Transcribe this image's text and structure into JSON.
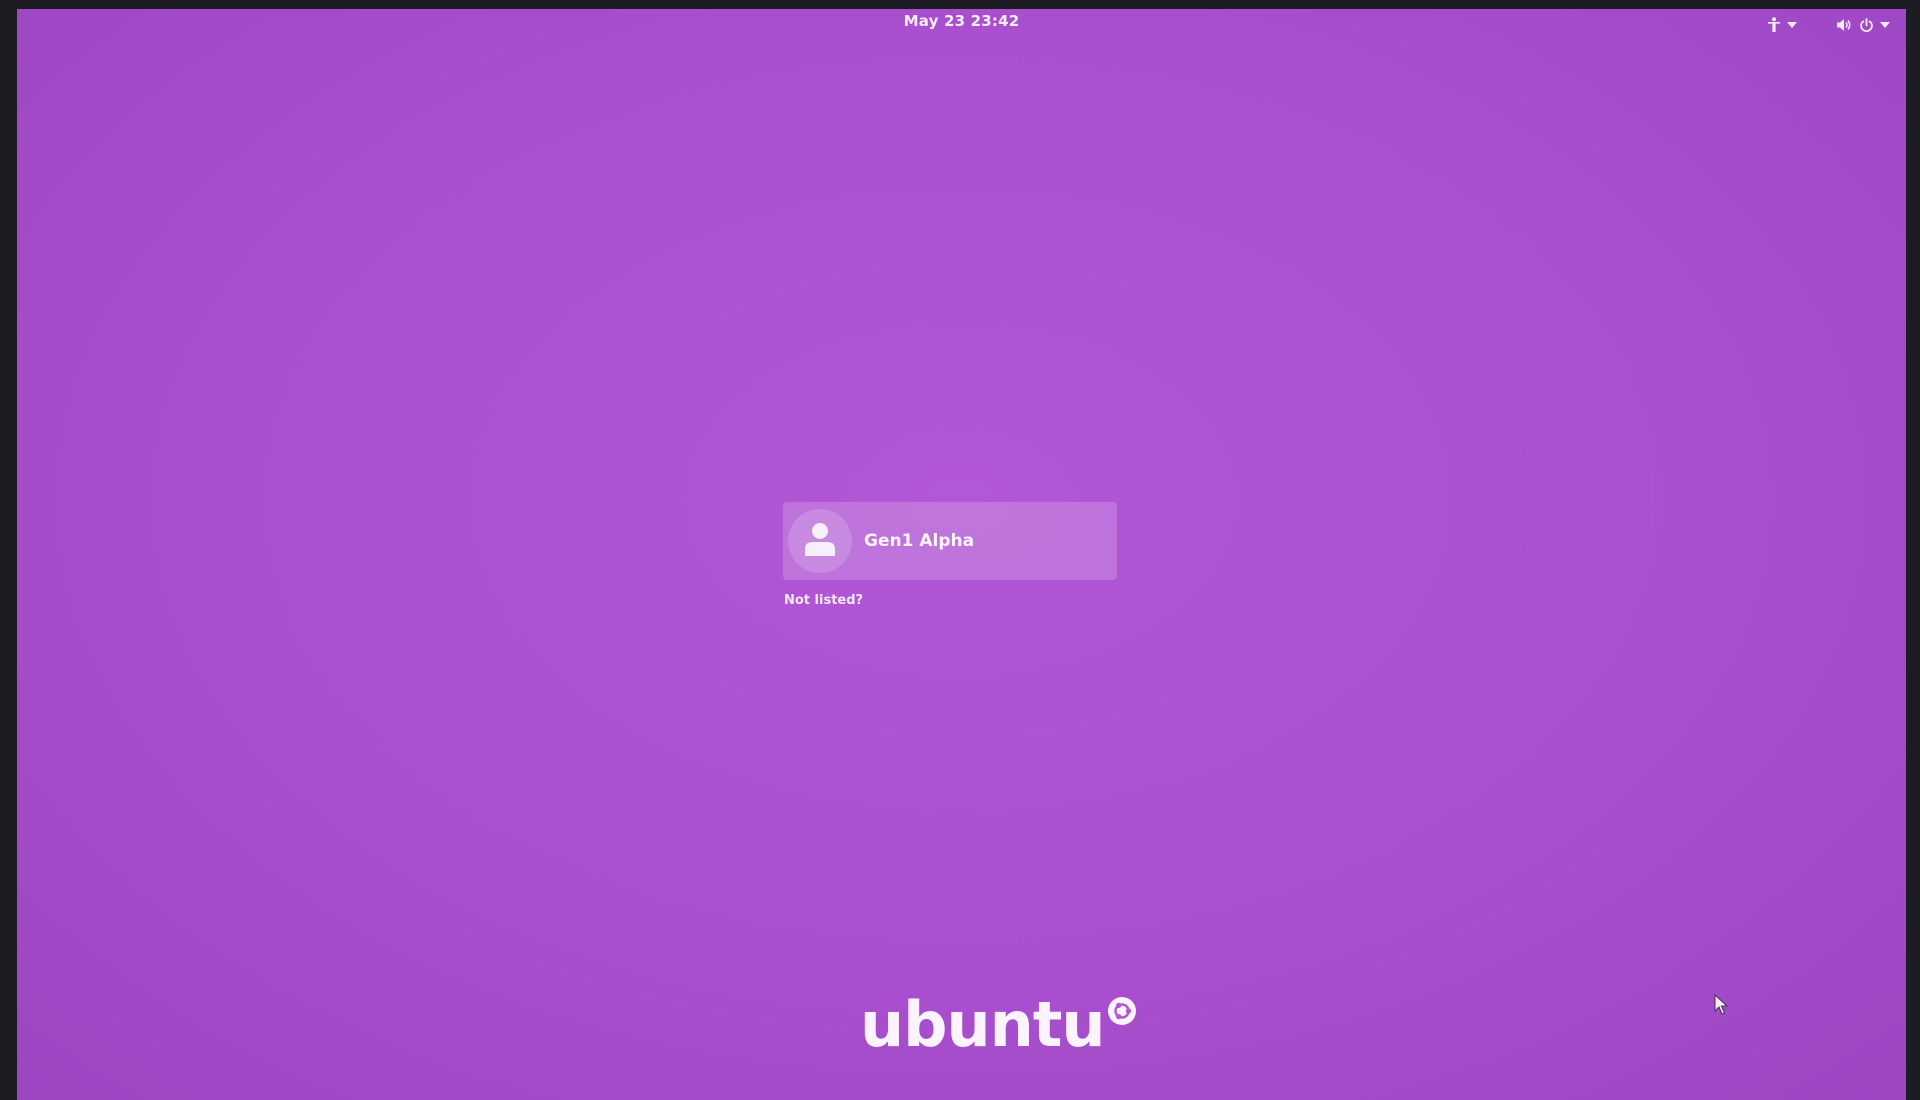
{
  "topbar": {
    "clock": "May 23  23:42",
    "icons": [
      "accessibility-icon",
      "chevron-down-icon",
      "volume-icon",
      "power-icon",
      "chevron-down-icon"
    ]
  },
  "login": {
    "user_name": "Gen1 Alpha",
    "not_listed_label": "Not listed?"
  },
  "branding": {
    "logo_text": "ubuntu"
  },
  "colors": {
    "background": "#ab50d0",
    "text": "#fbf5ff"
  }
}
